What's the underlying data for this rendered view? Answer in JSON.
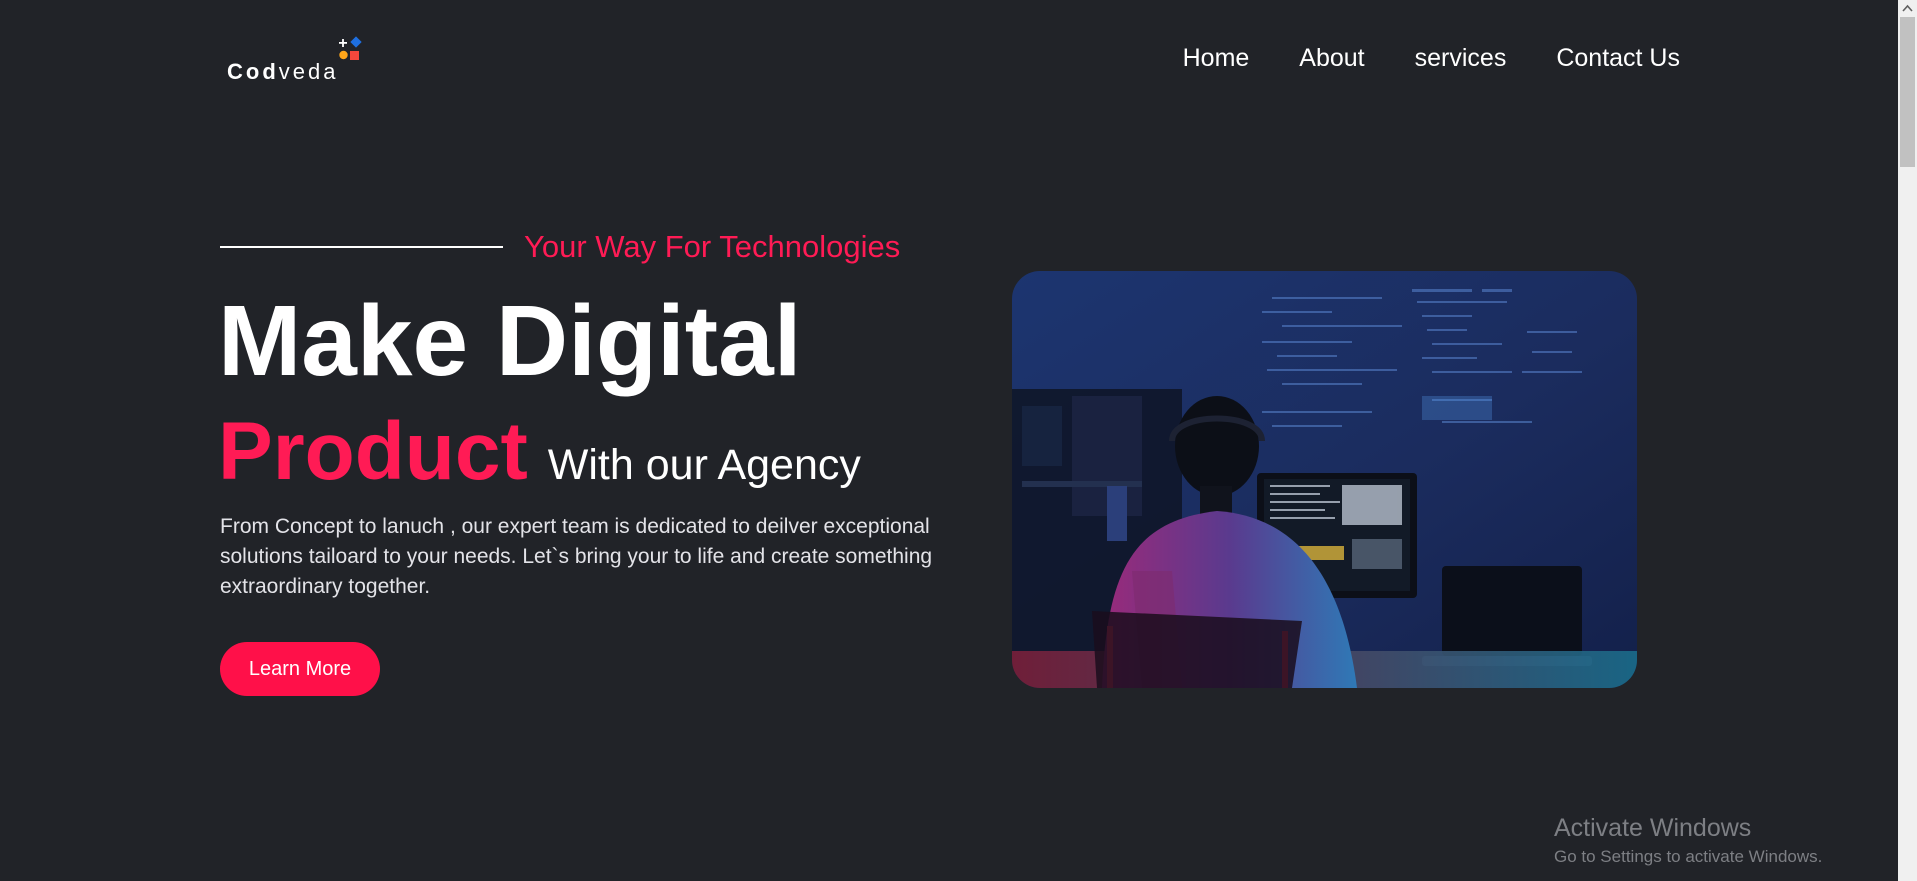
{
  "brand": {
    "name_bold": "Cod",
    "name_light": "veda",
    "icon": "plus-dots-squares-logo-icon",
    "colors": {
      "blue": "#1e6fe0",
      "orange": "#ffa61a",
      "red": "#f4473c"
    }
  },
  "nav": {
    "items": [
      {
        "label": "Home"
      },
      {
        "label": "About"
      },
      {
        "label": "services"
      },
      {
        "label": "Contact Us"
      }
    ]
  },
  "hero": {
    "tagline": "Your Way For Technologies",
    "headline_line1": "Make Digital",
    "headline_accent": "Product",
    "headline_rest": "With our Agency",
    "description": "From Concept to lanuch , our expert team is dedicated to deilver exceptional solutions tailoard to your needs. Let`s bring your to life and create something extraordinary together.",
    "cta_label": "Learn More",
    "image_icon": "developer-at-computer-photo"
  },
  "system": {
    "activate_title": "Activate Windows",
    "activate_subtitle": "Go to Settings to activate Windows."
  },
  "colors": {
    "background": "#212328",
    "accent": "#ff1b55",
    "button": "#ff1049",
    "text": "#ffffff"
  }
}
